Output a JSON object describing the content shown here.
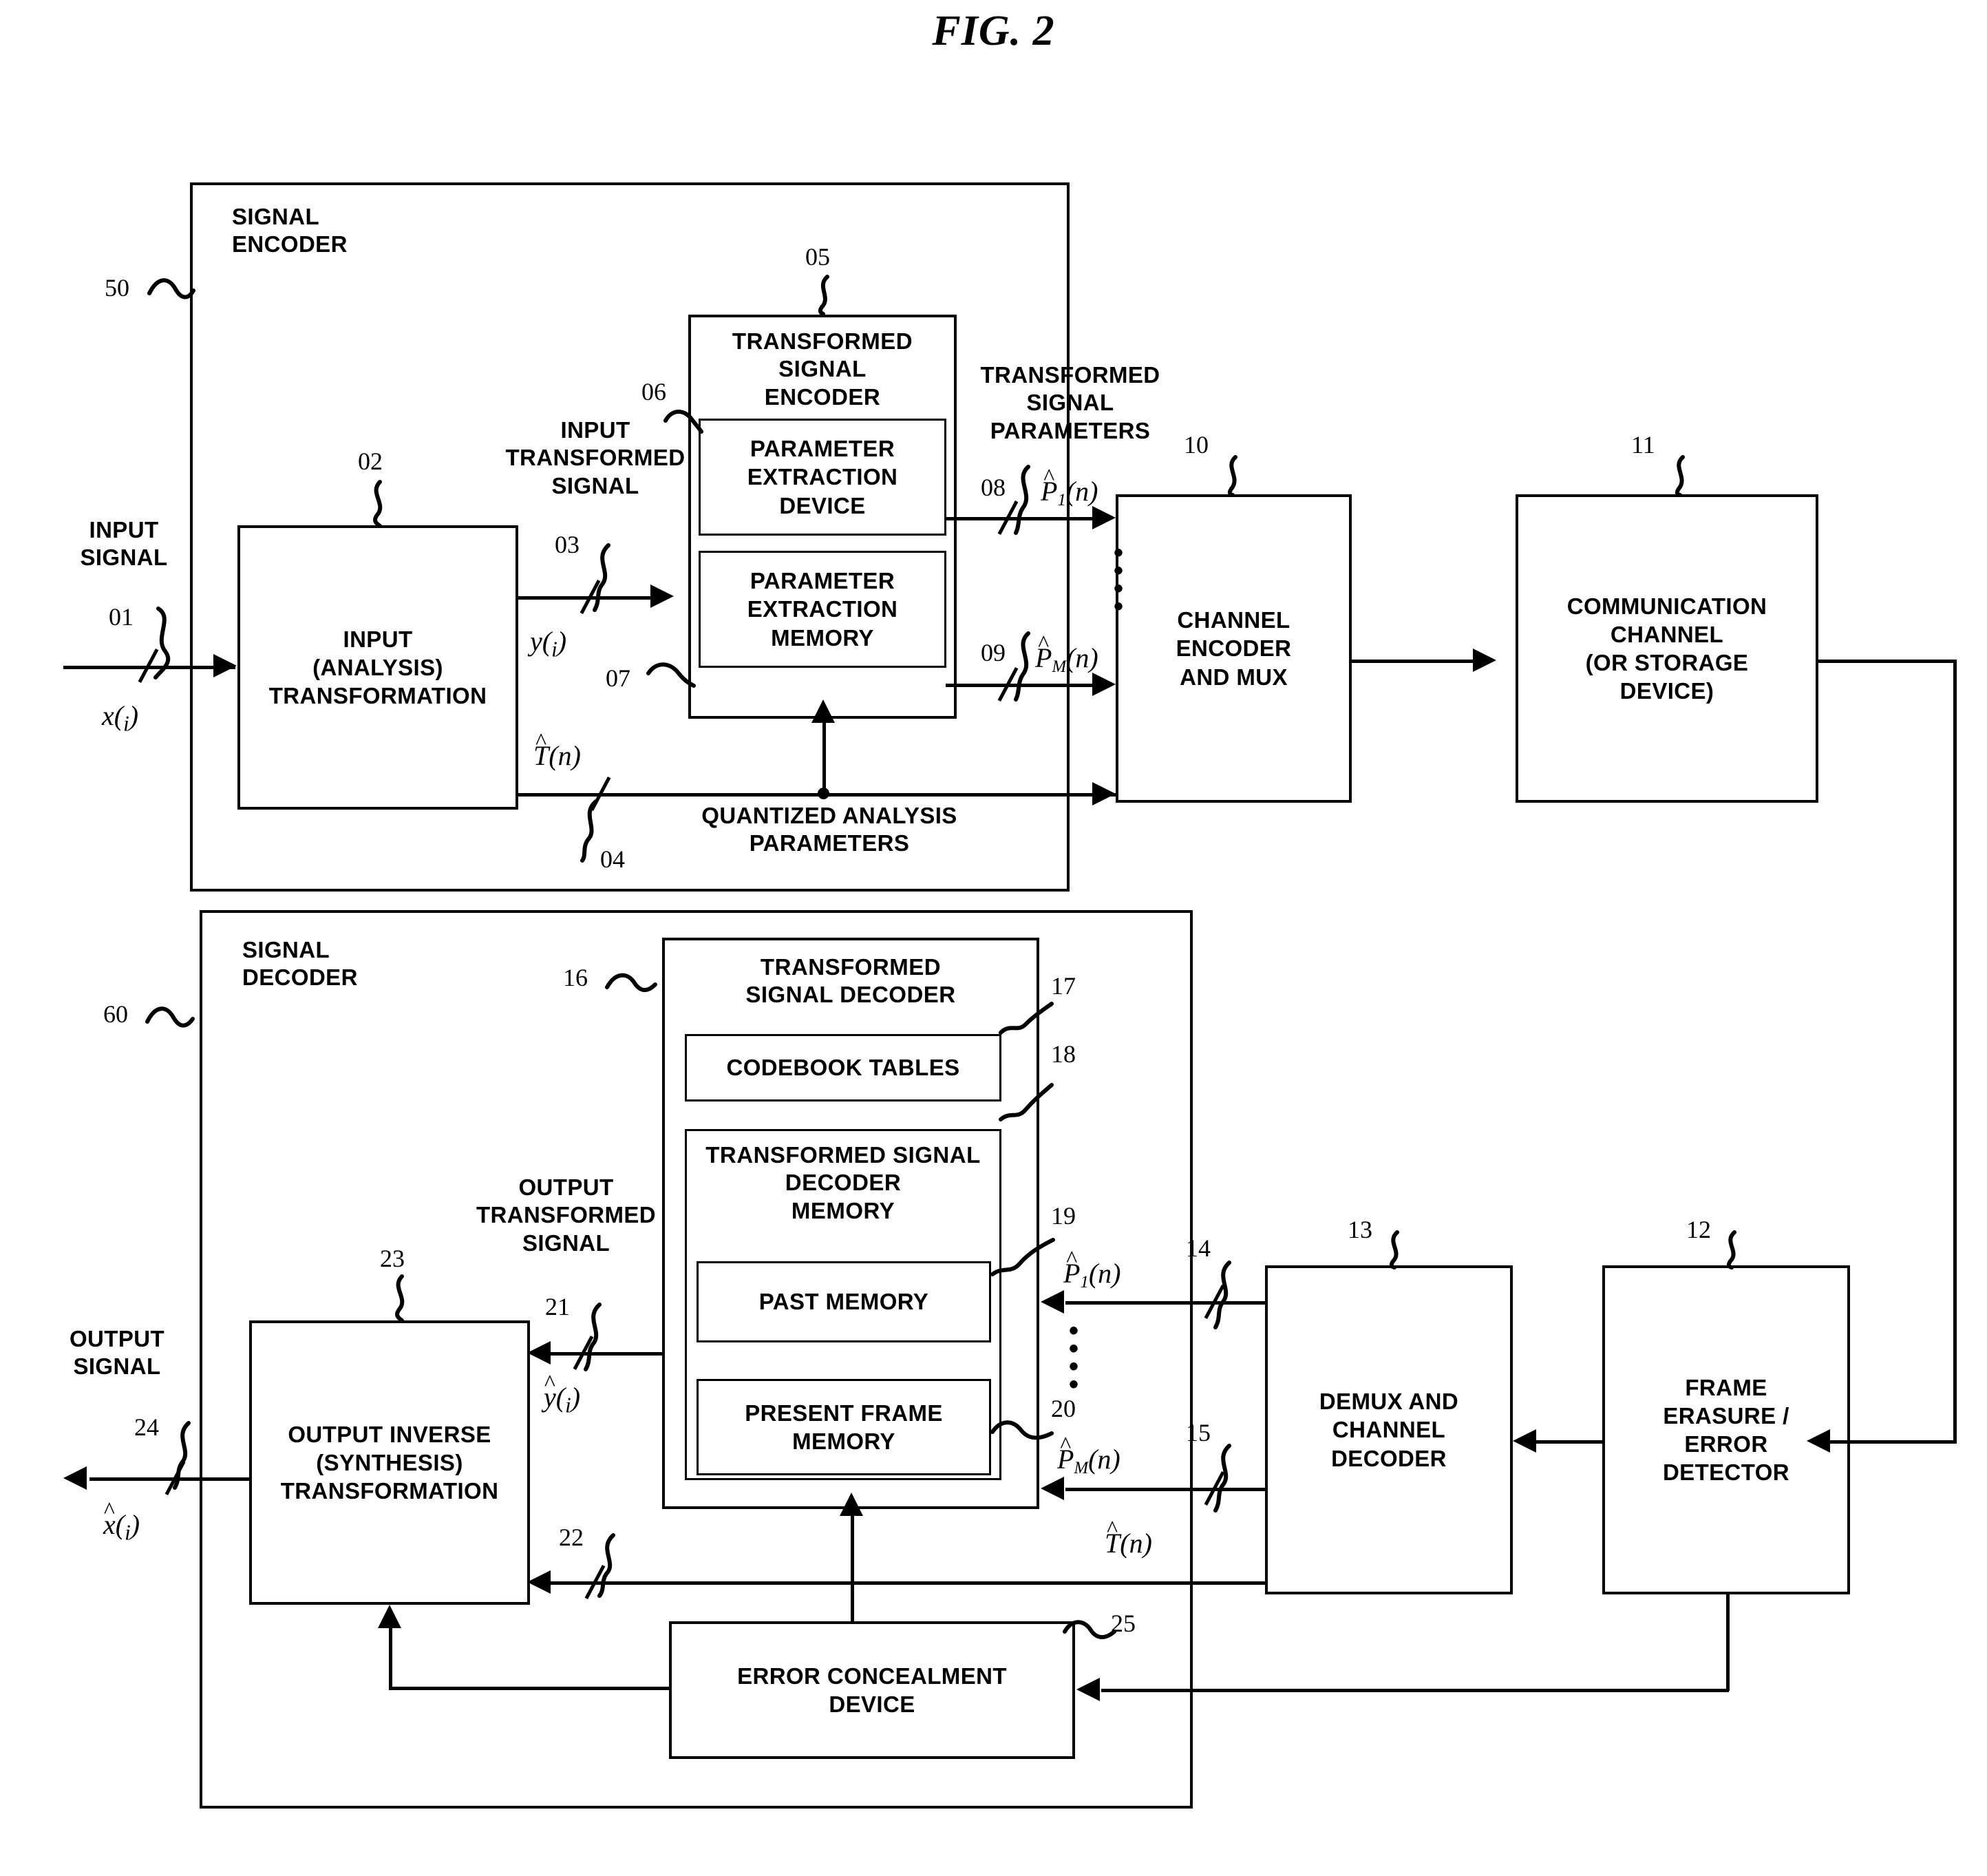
{
  "figure": {
    "title": "FIG. 2"
  },
  "encoder": {
    "frame_label": "SIGNAL\nENCODER",
    "frame_ref": "50",
    "input_signal_label": "INPUT\nSIGNAL",
    "input_signal_ref": "01",
    "input_signal_var": "x(i)",
    "transform_block": "INPUT\n(ANALYSIS)\nTRANSFORMATION",
    "transform_ref": "02",
    "input_transformed_label": "INPUT\nTRANSFORMED\nSIGNAL",
    "input_transformed_ref": "03",
    "input_transformed_var": "y(i)",
    "quantized_label": "QUANTIZED ANALYSIS\nPARAMETERS",
    "quantized_ref": "04",
    "quantized_var": "T(n)",
    "tse_title": "TRANSFORMED\nSIGNAL\nENCODER",
    "tse_ref": "05",
    "ped_label": "PARAMETER\nEXTRACTION\nDEVICE",
    "ped_ref": "06",
    "pem_label": "PARAMETER\nEXTRACTION\nMEMORY",
    "pem_ref": "07",
    "params_label": "TRANSFORMED\nSIGNAL\nPARAMETERS",
    "param_first_ref": "08",
    "param_first_var": "P1(n)",
    "param_last_ref": "09",
    "param_last_var": "PM(n)",
    "channel_encoder_label": "CHANNEL\nENCODER\nAND MUX",
    "channel_encoder_ref": "10"
  },
  "channel": {
    "label": "COMMUNICATION\nCHANNEL\n(OR STORAGE\nDEVICE)",
    "ref": "11"
  },
  "decoder": {
    "frame_label": "SIGNAL\nDECODER",
    "frame_ref": "60",
    "tsd_title": "TRANSFORMED\nSIGNAL DECODER",
    "tsd_ref": "16",
    "codebook_label": "CODEBOOK TABLES",
    "codebook_ref": "17",
    "tsdm_label": "TRANSFORMED SIGNAL\nDECODER\nMEMORY",
    "tsdm_ref": "18",
    "past_memory_label": "PAST MEMORY",
    "past_memory_ref": "19",
    "present_memory_label": "PRESENT FRAME\nMEMORY",
    "present_memory_ref": "20",
    "output_transformed_label": "OUTPUT\nTRANSFORMED\nSIGNAL",
    "output_transformed_ref": "21",
    "output_transformed_var": "y(i)",
    "t_param_ref": "22",
    "t_param_var": "T(n)",
    "inverse_block": "OUTPUT INVERSE\n(SYNTHESIS)\nTRANSFORMATION",
    "inverse_ref": "23",
    "output_signal_label": "OUTPUT\nSIGNAL",
    "output_signal_ref": "24",
    "output_signal_var": "x(i)",
    "error_concealment_label": "ERROR CONCEALMENT\nDEVICE",
    "error_concealment_ref": "25",
    "demux_label": "DEMUX AND\nCHANNEL\nDECODER",
    "demux_ref": "13",
    "frame_erasure_label": "FRAME\nERASURE /\nERROR\nDETECTOR",
    "frame_erasure_ref": "12",
    "param_first_ref": "14",
    "param_first_var": "P1(n)",
    "param_last_ref": "15",
    "param_last_var": "PM(n)"
  },
  "glyphs": {
    "ellipsis_vertical": "•\n•\n•\n•"
  }
}
